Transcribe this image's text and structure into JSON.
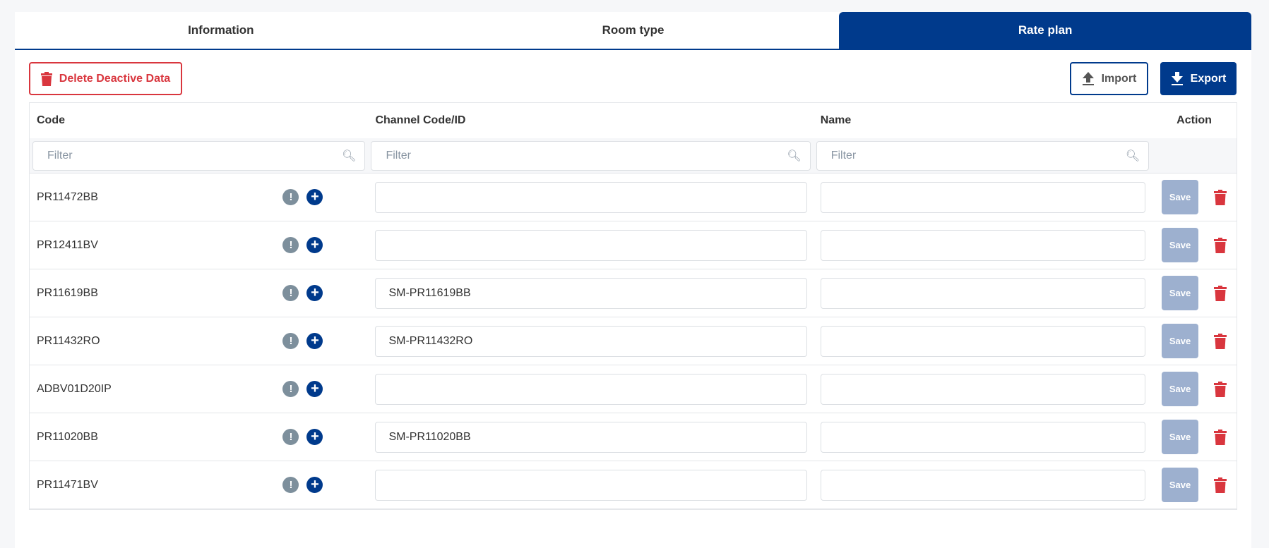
{
  "tabs": [
    {
      "label": "Information"
    },
    {
      "label": "Room type"
    },
    {
      "label": "Rate plan"
    }
  ],
  "toolbar": {
    "delete_label": "Delete Deactive Data",
    "import_label": "Import",
    "export_label": "Export"
  },
  "table": {
    "headers": {
      "code": "Code",
      "channel": "Channel Code/ID",
      "name": "Name",
      "action": "Action"
    },
    "filter_placeholder": "Filter",
    "save_label": "Save",
    "rows": [
      {
        "code": "PR11472BB",
        "channel": "",
        "name": ""
      },
      {
        "code": "PR12411BV",
        "channel": "",
        "name": ""
      },
      {
        "code": "PR11619BB",
        "channel": "SM-PR11619BB",
        "name": ""
      },
      {
        "code": "PR11432RO",
        "channel": "SM-PR11432RO",
        "name": ""
      },
      {
        "code": "ADBV01D20IP",
        "channel": "",
        "name": ""
      },
      {
        "code": "PR11020BB",
        "channel": "SM-PR11020BB",
        "name": ""
      },
      {
        "code": "PR11471BV",
        "channel": "",
        "name": ""
      }
    ]
  },
  "colors": {
    "primary": "#003a8c",
    "danger": "#d9363e",
    "save_disabled": "#9db0cf"
  }
}
